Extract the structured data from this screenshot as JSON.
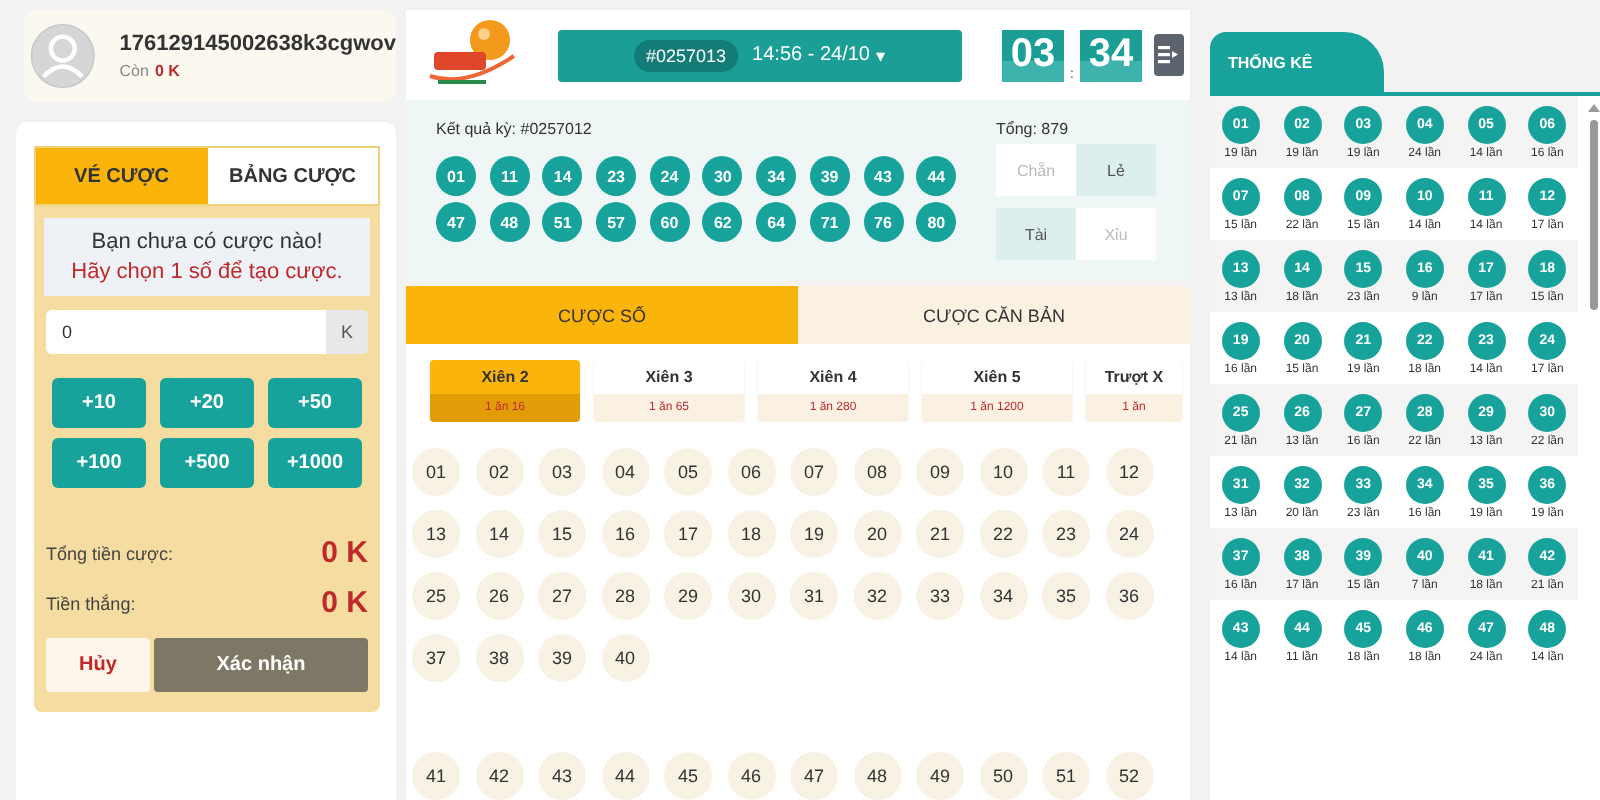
{
  "profile": {
    "username": "176129145002638k3cgwov",
    "balance_label": "Còn",
    "balance": "0 K"
  },
  "bet_panel": {
    "tabs": [
      {
        "label": "VÉ CƯỢC",
        "selected": true
      },
      {
        "label": "BẢNG CƯỢC",
        "selected": false
      }
    ],
    "message": "Bạn chưa có cược nào!",
    "hint": "Hãy chọn 1 số để tạo cược.",
    "amount": {
      "value": "0",
      "unit": "K"
    },
    "quick_amounts": [
      "+10",
      "+20",
      "+50",
      "+100",
      "+500",
      "+1000"
    ],
    "totals": [
      {
        "label": "Tổng tiền cược:",
        "value": "0 K"
      },
      {
        "label": "Tiền thắng:",
        "value": "0 K"
      }
    ],
    "buttons": [
      {
        "label": "Hủy",
        "kind": "cancel"
      },
      {
        "label": "Xác nhận",
        "kind": "confirm"
      }
    ]
  },
  "header": {
    "round": "#0257013",
    "time": "14:56 - 24/10",
    "caret": "▾",
    "timer": {
      "minutes": "03",
      "separator": ":",
      "seconds": "34"
    }
  },
  "results": {
    "label": "Kết quả kỳ: #0257012",
    "total": "Tổng: 879",
    "numbers": [
      "01",
      "11",
      "14",
      "23",
      "24",
      "30",
      "34",
      "39",
      "43",
      "44",
      "47",
      "48",
      "51",
      "57",
      "60",
      "62",
      "64",
      "71",
      "76",
      "80"
    ],
    "indicators": [
      {
        "label": "Chẵn",
        "active": false
      },
      {
        "label": "Lẻ",
        "active": true
      },
      {
        "label": "Tài",
        "active": true
      },
      {
        "label": "Xỉu",
        "active": false
      }
    ]
  },
  "bet_tabs": [
    {
      "label": "CƯỢC SỐ",
      "selected": true
    },
    {
      "label": "CƯỢC CĂN BẢN",
      "selected": false
    }
  ],
  "bet_types": [
    {
      "name": "Xiên 2",
      "odds": "1 ăn 16",
      "selected": true
    },
    {
      "name": "Xiên 3",
      "odds": "1 ăn 65",
      "selected": false
    },
    {
      "name": "Xiên 4",
      "odds": "1 ăn 280",
      "selected": false
    },
    {
      "name": "Xiên 5",
      "odds": "1 ăn 1200",
      "selected": false
    },
    {
      "name": "Trượt X",
      "odds": "1 ăn",
      "selected": false
    }
  ],
  "number_groups": [
    [
      "01",
      "02",
      "03",
      "04",
      "05",
      "06",
      "07",
      "08",
      "09",
      "10",
      "11",
      "12",
      "13",
      "14",
      "15",
      "16",
      "17",
      "18",
      "19",
      "20",
      "21",
      "22",
      "23",
      "24",
      "25",
      "26",
      "27",
      "28",
      "29",
      "30",
      "31",
      "32",
      "33",
      "34",
      "35",
      "36",
      "37",
      "38",
      "39",
      "40"
    ],
    [
      "41",
      "42",
      "43",
      "44",
      "45",
      "46",
      "47",
      "48",
      "49",
      "50",
      "51",
      "52"
    ]
  ],
  "stats": {
    "title": "THỐNG KÊ",
    "items": [
      {
        "number": "01",
        "count": "19 lần"
      },
      {
        "number": "02",
        "count": "19 lần"
      },
      {
        "number": "03",
        "count": "19 lần"
      },
      {
        "number": "04",
        "count": "24 lần"
      },
      {
        "number": "05",
        "count": "14 lần"
      },
      {
        "number": "06",
        "count": "16 lần"
      },
      {
        "number": "07",
        "count": "15 lần"
      },
      {
        "number": "08",
        "count": "22 lần"
      },
      {
        "number": "09",
        "count": "15 lần"
      },
      {
        "number": "10",
        "count": "14 lần"
      },
      {
        "number": "11",
        "count": "14 lần"
      },
      {
        "number": "12",
        "count": "17 lần"
      },
      {
        "number": "13",
        "count": "13 lần"
      },
      {
        "number": "14",
        "count": "18 lần"
      },
      {
        "number": "15",
        "count": "23 lần"
      },
      {
        "number": "16",
        "count": "9 lần"
      },
      {
        "number": "17",
        "count": "17 lần"
      },
      {
        "number": "18",
        "count": "15 lần"
      },
      {
        "number": "19",
        "count": "16 lần"
      },
      {
        "number": "20",
        "count": "15 lần"
      },
      {
        "number": "21",
        "count": "19 lần"
      },
      {
        "number": "22",
        "count": "18 lần"
      },
      {
        "number": "23",
        "count": "14 lần"
      },
      {
        "number": "24",
        "count": "17 lần"
      },
      {
        "number": "25",
        "count": "21 lần"
      },
      {
        "number": "26",
        "count": "13 lần"
      },
      {
        "number": "27",
        "count": "16 lần"
      },
      {
        "number": "28",
        "count": "22 lần"
      },
      {
        "number": "29",
        "count": "13 lần"
      },
      {
        "number": "30",
        "count": "22 lần"
      },
      {
        "number": "31",
        "count": "13 lần"
      },
      {
        "number": "32",
        "count": "20 lần"
      },
      {
        "number": "33",
        "count": "23 lần"
      },
      {
        "number": "34",
        "count": "16 lần"
      },
      {
        "number": "35",
        "count": "19 lần"
      },
      {
        "number": "36",
        "count": "19 lần"
      },
      {
        "number": "37",
        "count": "16 lần"
      },
      {
        "number": "38",
        "count": "17 lần"
      },
      {
        "number": "39",
        "count": "15 lần"
      },
      {
        "number": "40",
        "count": "7 lần"
      },
      {
        "number": "41",
        "count": "18 lần"
      },
      {
        "number": "42",
        "count": "21 lần"
      },
      {
        "number": "43",
        "count": "14 lần"
      },
      {
        "number": "44",
        "count": "11 lần"
      },
      {
        "number": "45",
        "count": "18 lần"
      },
      {
        "number": "46",
        "count": "18 lần"
      },
      {
        "number": "47",
        "count": "24 lần"
      },
      {
        "number": "48",
        "count": "14 lần"
      }
    ]
  }
}
